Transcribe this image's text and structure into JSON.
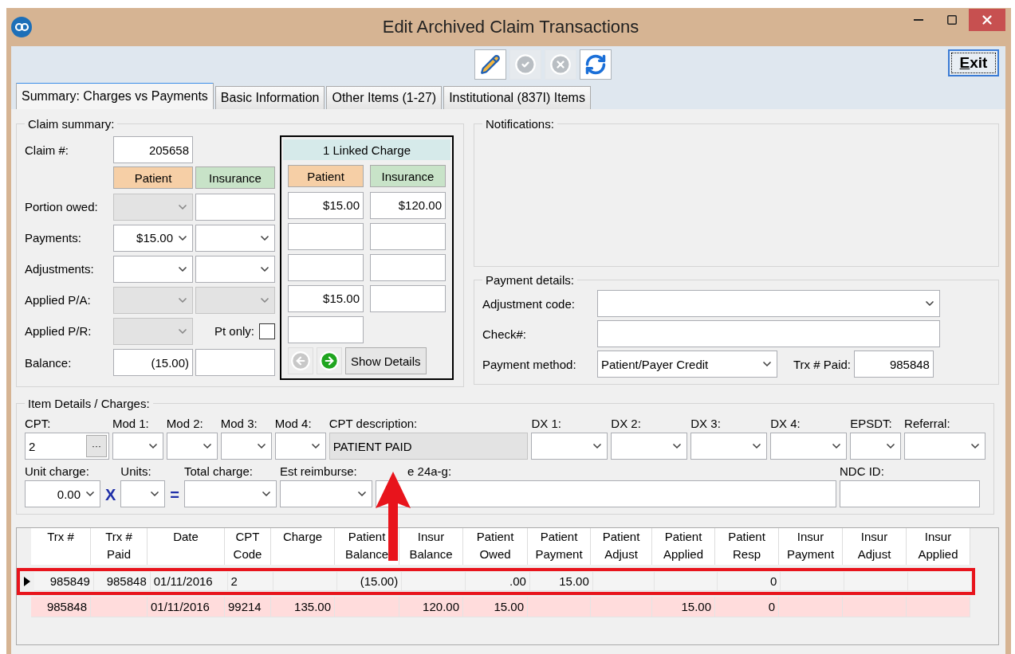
{
  "window": {
    "title": "Edit Archived Claim Transactions",
    "controls": [
      {
        "kind": "minimize"
      },
      {
        "kind": "maximize"
      },
      {
        "kind": "close"
      }
    ]
  },
  "toolbar": {
    "buttons": [
      {
        "kind": "edit",
        "disabled": false
      },
      {
        "kind": "confirm",
        "disabled": true
      },
      {
        "kind": "cancel",
        "disabled": true
      },
      {
        "kind": "refresh",
        "disabled": false
      }
    ],
    "exit": "Exit"
  },
  "tabs": [
    {
      "label": "Summary: Charges vs Payments",
      "selected": true
    },
    {
      "label": "Basic Information",
      "selected": false
    },
    {
      "label": "Other Items (1-27)",
      "selected": false
    },
    {
      "label": "Institutional (837I) Items",
      "selected": false
    }
  ],
  "claim_summary": {
    "title": "Claim summary:",
    "claim_label": "Claim #:",
    "claim_value": "205658",
    "headers": [
      {
        "label": "Patient",
        "color": "#f6cfa6"
      },
      {
        "label": "Insurance",
        "color": "#c8e3c8"
      }
    ],
    "rows": [
      {
        "label": "Portion owed:",
        "patient": {
          "kind": "dropdown",
          "disabled": true
        },
        "insurance": {
          "kind": "text",
          "disabled": false
        }
      },
      {
        "label": "Payments:",
        "patient": {
          "kind": "dropdown",
          "value": "$15.00",
          "disabled": false
        },
        "insurance": {
          "kind": "dropdown",
          "disabled": false
        }
      },
      {
        "label": "Adjustments:",
        "patient": {
          "kind": "dropdown",
          "disabled": false
        },
        "insurance": {
          "kind": "dropdown",
          "disabled": false
        }
      },
      {
        "label": "Applied P/A:",
        "patient": {
          "kind": "dropdown",
          "disabled": true
        },
        "insurance": {
          "kind": "dropdown",
          "disabled": true
        }
      },
      {
        "label": "Applied P/R:",
        "patient": {
          "kind": "dropdown",
          "disabled": true
        },
        "insurance": {
          "kind": "checkbox",
          "label": "Pt only:",
          "checked": false
        }
      },
      {
        "label": "Balance:",
        "patient": {
          "kind": "text",
          "value": "(15.00)",
          "disabled": false
        },
        "insurance": {
          "kind": "text",
          "disabled": false
        }
      }
    ]
  },
  "linked_charge": {
    "title": "1 Linked Charge",
    "headers": [
      {
        "label": "Patient",
        "color": "#f6cfa6"
      },
      {
        "label": "Insurance",
        "color": "#c8e3c8"
      }
    ],
    "rows": [
      [
        "$15.00",
        "$120.00"
      ],
      [
        null,
        null
      ],
      [
        null,
        null
      ],
      [
        "$15.00",
        null
      ],
      [
        null
      ]
    ],
    "buttons": [
      {
        "kind": "previous",
        "disabled": true
      },
      {
        "kind": "next",
        "disabled": false
      }
    ],
    "details_button": "Show Details"
  },
  "notifications": {
    "title": "Notifications:"
  },
  "payment_details": {
    "title": "Payment details:",
    "adjustment_code": {
      "label": "Adjustment code:"
    },
    "check": {
      "label": "Check#:"
    },
    "payment_method": {
      "label": "Payment method:",
      "value": "Patient/Payer Credit"
    },
    "trx_paid": {
      "label": "Trx # Paid:",
      "value": "985848"
    }
  },
  "item_details": {
    "title": "Item Details / Charges:",
    "row1": [
      {
        "kind": "lookup",
        "label": "CPT:",
        "value": "2",
        "button": "···"
      },
      {
        "kind": "dropdown",
        "label": "Mod 1:"
      },
      {
        "kind": "dropdown",
        "label": "Mod 2:"
      },
      {
        "kind": "dropdown",
        "label": "Mod 3:"
      },
      {
        "kind": "dropdown",
        "label": "Mod 4:"
      },
      {
        "kind": "readonly",
        "label": "CPT description:",
        "value": "PATIENT PAID"
      },
      {
        "kind": "dropdown",
        "label": "DX 1:"
      },
      {
        "kind": "dropdown",
        "label": "DX 2:"
      },
      {
        "kind": "dropdown",
        "label": "DX 3:"
      },
      {
        "kind": "dropdown",
        "label": "DX 4:"
      },
      {
        "kind": "dropdown",
        "label": "EPSDT:"
      },
      {
        "kind": "dropdown",
        "label": "Referral:"
      }
    ],
    "row2": [
      {
        "kind": "dropdown",
        "label": "Unit charge:",
        "value": "0.00"
      },
      {
        "kind": "operator",
        "label": "X"
      },
      {
        "kind": "dropdown",
        "label": "Units:"
      },
      {
        "kind": "operator",
        "label": "="
      },
      {
        "kind": "dropdown",
        "label": "Total charge:"
      },
      {
        "kind": "dropdown",
        "label": "Est reimburse:"
      },
      {
        "kind": "text",
        "label": "e 24a-g:"
      },
      {
        "kind": "text",
        "label": "NDC ID:"
      }
    ]
  },
  "table": {
    "columns": [
      "Trx #",
      "Trx #\nPaid",
      "Date",
      "CPT\nCode",
      "Charge",
      "Patient\nBalance",
      "Insur\nBalance",
      "Patient\nOwed",
      "Patient\nPayment",
      "Patient\nAdjust",
      "Patient\nApplied",
      "Patient\nResp",
      "Insur\nPayment",
      "Insur\nAdjust",
      "Insur\nApplied"
    ],
    "rows": [
      {
        "current": true,
        "annotated": true,
        "flagged": false,
        "cells": [
          "985849",
          "985848",
          "01/11/2016",
          "2",
          null,
          "(15.00)",
          null,
          ".00",
          "15.00",
          null,
          null,
          "0",
          null,
          null,
          null
        ]
      },
      {
        "current": false,
        "annotated": false,
        "flagged": true,
        "cells": [
          "985848",
          null,
          "01/11/2016",
          "99214",
          "135.00",
          null,
          "120.00",
          "15.00",
          null,
          null,
          "15.00",
          "0",
          null,
          null,
          null
        ]
      }
    ]
  },
  "annotation": {
    "arrow": true
  }
}
